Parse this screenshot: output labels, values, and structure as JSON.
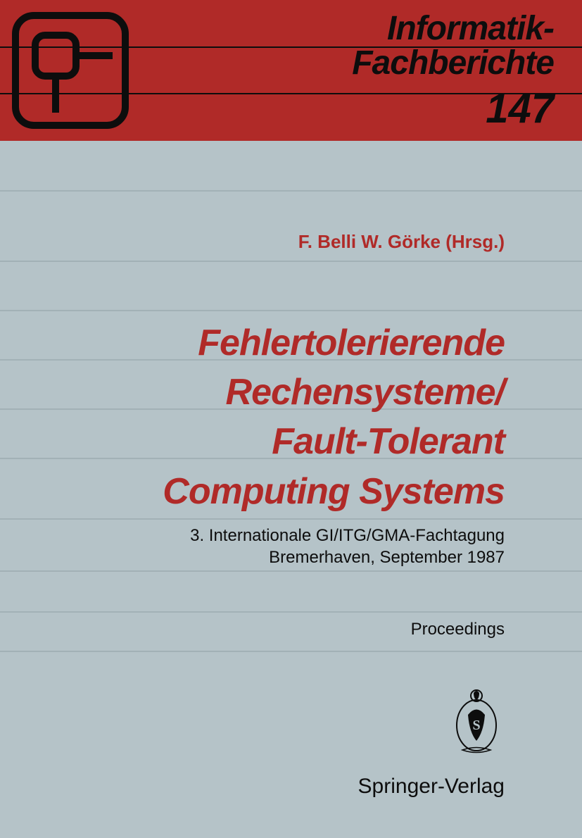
{
  "series": {
    "line1": "Informatik-",
    "line2": "Fachberichte",
    "number": "147"
  },
  "authors": "F. Belli   W. Görke (Hrsg.)",
  "title": {
    "line1": "Fehlertolerierende",
    "line2": "Rechensysteme/",
    "line3": "Fault-Tolerant",
    "line4": "Computing Systems"
  },
  "subtitle": {
    "line1": "3. Internationale GI/ITG/GMA-Fachtagung",
    "line2": "Bremerhaven, September 1987"
  },
  "proceedings": "Proceedings",
  "publisher": "Springer-Verlag",
  "colors": {
    "red": "#b02a28",
    "bg": "#b5c3c8",
    "dark": "#0d0d0d"
  }
}
